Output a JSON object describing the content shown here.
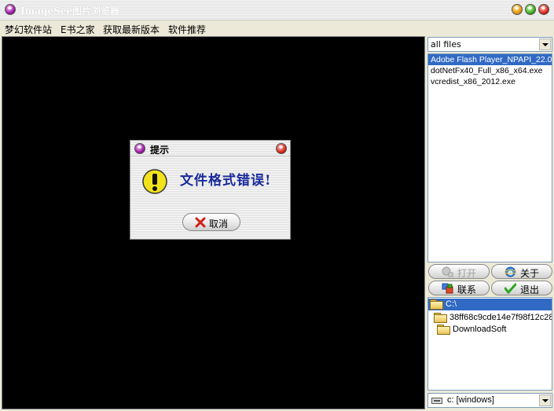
{
  "window": {
    "title": "ImageSee图片浏览器"
  },
  "menu": {
    "items": [
      "梦幻软件站",
      "E书之家",
      "获取最新版本",
      "软件推荐"
    ]
  },
  "filter": {
    "selected": "all files"
  },
  "files": [
    "Adobe Flash Player_NPAPI_22.0",
    "dotNetFx40_Full_x86_x64.exe",
    "vcredist_x86_2012.exe"
  ],
  "buttons": {
    "open": "打开",
    "about": "关于",
    "contact": "联系",
    "exit": "退出"
  },
  "tree": {
    "items": [
      "C:\\",
      "38ff68c9cde14e7f98f12c28",
      "DownloadSoft"
    ]
  },
  "drive": {
    "selected": "c: [windows]"
  },
  "dialog": {
    "title": "提示",
    "message": "文件格式错误!",
    "cancel": "取消"
  },
  "icons": {
    "app": "app-orb-icon",
    "warning": "warning-icon",
    "cancel": "red-x-icon",
    "open": "open-icon",
    "about": "ie-globe-icon",
    "contact": "contact-icon",
    "exit": "green-check-icon",
    "folder": "folder-icon",
    "drive": "drive-icon"
  },
  "colors": {
    "selection": "#316ac5",
    "dialog_message": "#1a2b9a",
    "viewer_bg": "#000000"
  }
}
